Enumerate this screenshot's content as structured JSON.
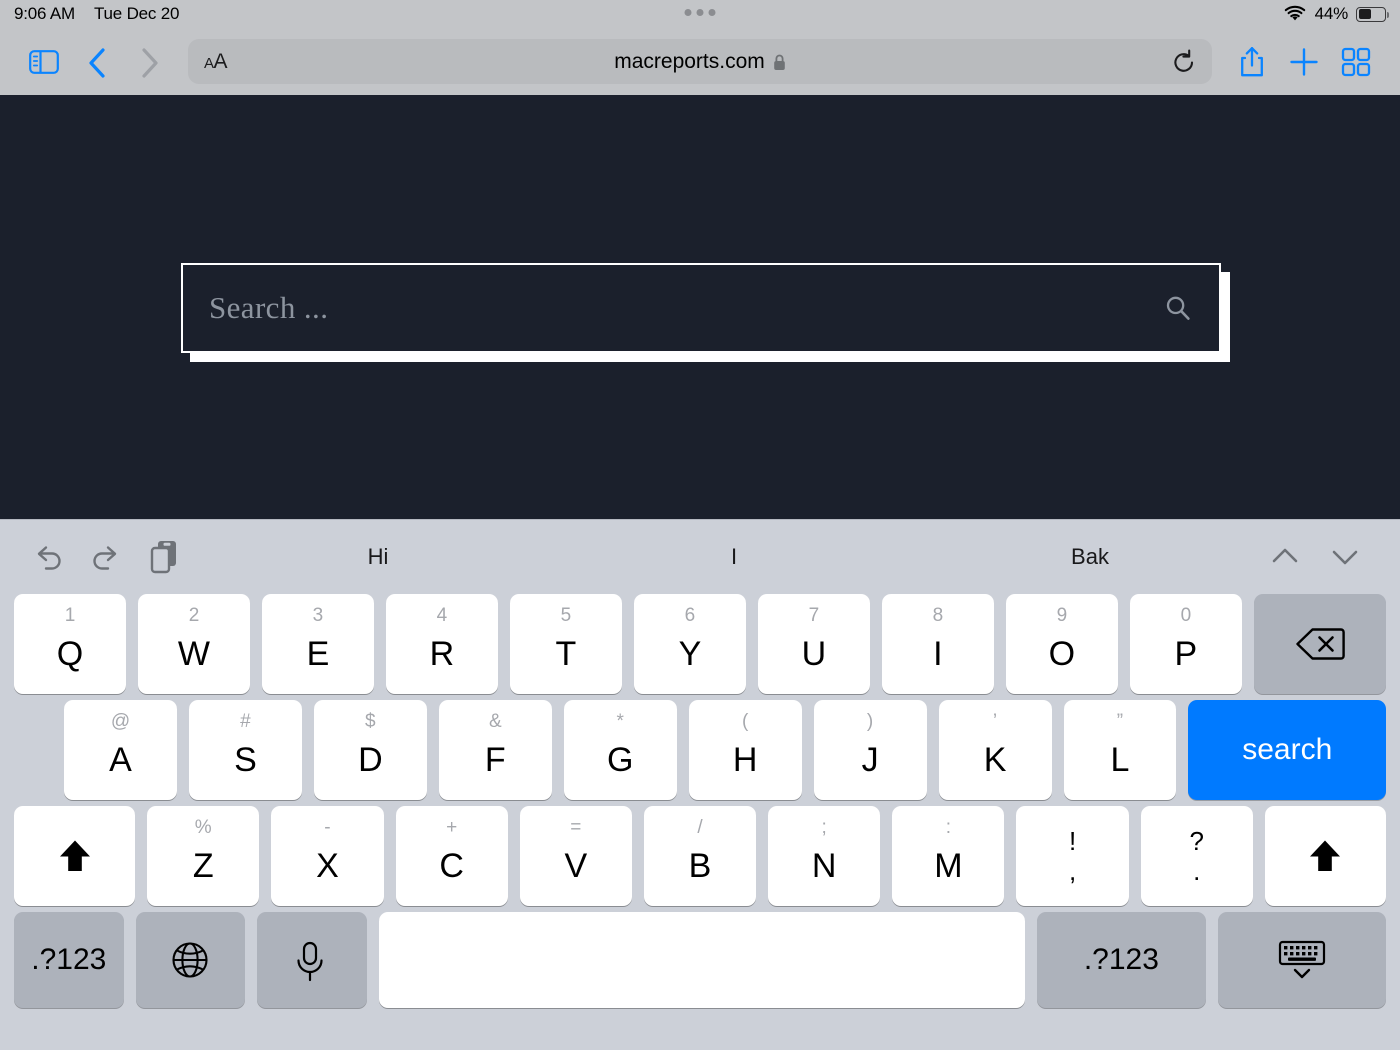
{
  "status_bar": {
    "time": "9:06 AM",
    "date": "Tue Dec 20",
    "battery_percent": "44%",
    "wifi_icon": "wifi-icon",
    "battery_icon": "battery-icon"
  },
  "toolbar": {
    "sidebar_icon": "sidebar-icon",
    "back_icon": "chevron-left-icon",
    "forward_icon": "chevron-right-icon",
    "text_size_label": "AA",
    "url": "macreports.com",
    "lock_icon": "lock-icon",
    "reload_icon": "reload-icon",
    "share_icon": "share-icon",
    "new_tab_icon": "plus-icon",
    "tabs_icon": "tab-overview-icon"
  },
  "page": {
    "background_color": "#1b202c",
    "search": {
      "placeholder": "Search ...",
      "value": "",
      "search_icon": "magnifier-icon"
    }
  },
  "keyboard": {
    "suggestion_bar": {
      "undo_icon": "undo-icon",
      "redo_icon": "redo-icon",
      "paste_icon": "paste-icon",
      "predictions": [
        "Hi",
        "I",
        "Bak"
      ],
      "up_icon": "chevron-up-icon",
      "down_icon": "chevron-down-icon"
    },
    "return_key_label": "search",
    "return_key_color": "#007aff",
    "numeric_key_label": ".?123",
    "numeric_key_label_right": ".?123",
    "globe_icon": "globe-icon",
    "mic_icon": "microphone-icon",
    "dismiss_icon": "dismiss-keyboard-icon",
    "backspace_icon": "backspace-icon",
    "shift_icon": "shift-icon",
    "rows": [
      [
        {
          "main": "Q",
          "alt": "1"
        },
        {
          "main": "W",
          "alt": "2"
        },
        {
          "main": "E",
          "alt": "3"
        },
        {
          "main": "R",
          "alt": "4"
        },
        {
          "main": "T",
          "alt": "5"
        },
        {
          "main": "Y",
          "alt": "6"
        },
        {
          "main": "U",
          "alt": "7"
        },
        {
          "main": "I",
          "alt": "8"
        },
        {
          "main": "O",
          "alt": "9"
        },
        {
          "main": "P",
          "alt": "0"
        }
      ],
      [
        {
          "main": "A",
          "alt": "@"
        },
        {
          "main": "S",
          "alt": "#"
        },
        {
          "main": "D",
          "alt": "$"
        },
        {
          "main": "F",
          "alt": "&"
        },
        {
          "main": "G",
          "alt": "*"
        },
        {
          "main": "H",
          "alt": "("
        },
        {
          "main": "J",
          "alt": ")"
        },
        {
          "main": "K",
          "alt": "’"
        },
        {
          "main": "L",
          "alt": "”"
        }
      ],
      [
        {
          "main": "Z",
          "alt": "%"
        },
        {
          "main": "X",
          "alt": "-"
        },
        {
          "main": "C",
          "alt": "+"
        },
        {
          "main": "V",
          "alt": "="
        },
        {
          "main": "B",
          "alt": "/"
        },
        {
          "main": "N",
          "alt": ";"
        },
        {
          "main": "M",
          "alt": ":"
        }
      ]
    ],
    "punct_keys": [
      {
        "up": "!",
        "dn": ","
      },
      {
        "up": "?",
        "dn": "."
      }
    ]
  }
}
